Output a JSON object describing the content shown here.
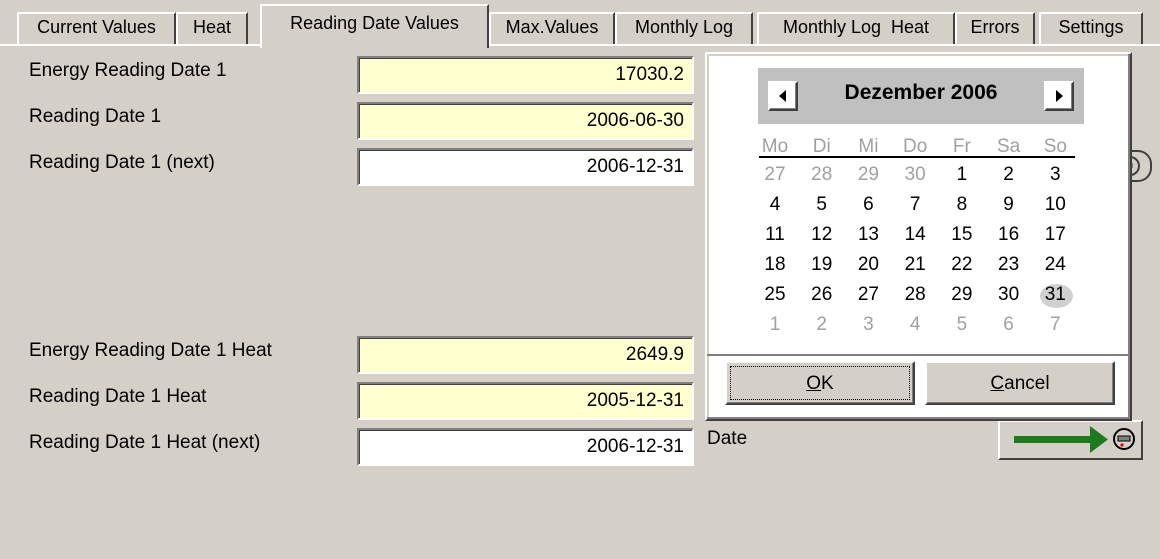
{
  "tabs": [
    {
      "label": "Current Values"
    },
    {
      "label": "Heat"
    },
    {
      "label": "Reading Date Values",
      "active": true
    },
    {
      "label": "Max.Values"
    },
    {
      "label": "Monthly Log"
    },
    {
      "label": "Monthly Log  Heat"
    },
    {
      "label": "Errors"
    },
    {
      "label": "Settings"
    }
  ],
  "fields": [
    {
      "label": "Energy Reading Date 1",
      "value": "17030.2",
      "style": "yellow"
    },
    {
      "label": "Reading Date 1",
      "value": "2006-06-30",
      "style": "yellow"
    },
    {
      "label": "Reading Date 1 (next)",
      "value": "2006-12-31",
      "style": "white"
    },
    {
      "label": "Energy Reading Date 1 Heat",
      "value": "2649.9",
      "style": "yellow"
    },
    {
      "label": "Reading Date 1 Heat",
      "value": "2005-12-31",
      "style": "yellow"
    },
    {
      "label": "Reading Date 1 Heat (next)",
      "value": "2006-12-31",
      "style": "white"
    }
  ],
  "calendar": {
    "month_title": "Dezember 2006",
    "prev_icon": "triangle-left-icon",
    "next_icon": "triangle-right-icon",
    "weekdays": [
      "Mo",
      "Di",
      "Mi",
      "Do",
      "Fr",
      "Sa",
      "So"
    ],
    "weeks": [
      [
        "27",
        "28",
        "29",
        "30",
        "1",
        "2",
        "3"
      ],
      [
        "4",
        "5",
        "6",
        "7",
        "8",
        "9",
        "10"
      ],
      [
        "11",
        "12",
        "13",
        "14",
        "15",
        "16",
        "17"
      ],
      [
        "18",
        "19",
        "20",
        "21",
        "22",
        "23",
        "24"
      ],
      [
        "25",
        "26",
        "27",
        "28",
        "29",
        "30",
        "31"
      ],
      [
        "1",
        "2",
        "3",
        "4",
        "5",
        "6",
        "7"
      ]
    ],
    "other_month_flags": [
      [
        true,
        true,
        true,
        true,
        false,
        false,
        false
      ],
      [
        false,
        false,
        false,
        false,
        false,
        false,
        false
      ],
      [
        false,
        false,
        false,
        false,
        false,
        false,
        false
      ],
      [
        false,
        false,
        false,
        false,
        false,
        false,
        false
      ],
      [
        false,
        false,
        false,
        false,
        false,
        false,
        false
      ],
      [
        true,
        true,
        true,
        true,
        true,
        true,
        true
      ]
    ],
    "selected_day": "31",
    "ok_label": "OK",
    "ok_mnemonic": "O",
    "ok_rest": "K",
    "cancel_label": "Cancel",
    "cancel_mnemonic": "C",
    "cancel_rest": "ancel"
  },
  "date_label": "Date",
  "colors": {
    "background": "#d4d0c8",
    "field_yellow": "#ffffd0",
    "arrow_green": "#1f7a1f"
  }
}
